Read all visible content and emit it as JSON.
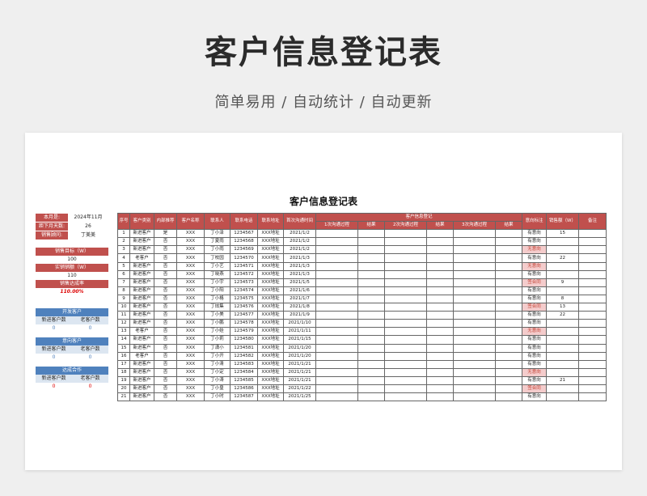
{
  "hero": {
    "title": "客户信息登记表",
    "subtitle": "简单易用  /  自动统计  /  自动更新"
  },
  "sheet_title": "客户信息登记表",
  "side": {
    "month_label": "本月是:",
    "month_value": "2024年11月",
    "days_label": "距下月天数:",
    "days_value": "26",
    "sales_label": "销售顾问:",
    "sales_value": "丁美美",
    "target_label": "销售目标（W）",
    "target_value": "100",
    "actual_label": "实销销额（W）",
    "actual_value": "110",
    "rate_label": "销售达成率",
    "rate_value": "110.00%",
    "blocks": [
      {
        "title": "开发客户",
        "col_a": "新进客户数",
        "col_b": "老客户数",
        "val_a": "0",
        "val_b": "0"
      },
      {
        "title": "意向客户",
        "col_a": "新进客户数",
        "col_b": "老客户数",
        "val_a": "0",
        "val_b": "0"
      },
      {
        "title": "达成合作",
        "col_a": "新进客户数",
        "col_b": "老客户数",
        "val_a": "0",
        "val_b": "0"
      }
    ]
  },
  "table": {
    "headers": [
      "序号",
      "客户类别",
      "内部推荐",
      "客户名称",
      "联系人",
      "联系电话",
      "联系地址",
      "首次沟通时间"
    ],
    "group_header": "客户信息登记",
    "sub_headers": [
      "1次沟通过程",
      "结果",
      "2次沟通过程",
      "结果",
      "3次沟通过程",
      "结果"
    ],
    "tail_headers": [
      "意向标注",
      "销售额（W）",
      "备注"
    ],
    "rows": [
      [
        "1",
        "新进客户",
        "是",
        "XXX",
        "丁小泽",
        "1234567",
        "XXX地址",
        "2021/1/2",
        "有意向",
        "15"
      ],
      [
        "2",
        "新进客户",
        "否",
        "XXX",
        "丁夏雨",
        "1234568",
        "XXX地址",
        "2021/1/2",
        "有意向",
        ""
      ],
      [
        "3",
        "新进客户",
        "否",
        "XXX",
        "丁小雨",
        "1234569",
        "XXX地址",
        "2021/1/2",
        "无意向",
        ""
      ],
      [
        "4",
        "老客户",
        "否",
        "XXX",
        "丁校园",
        "1234570",
        "XXX地址",
        "2021/1/3",
        "有意向",
        "22"
      ],
      [
        "5",
        "新进客户",
        "否",
        "XXX",
        "丁小艺",
        "1234571",
        "XXX地址",
        "2021/1/3",
        "无意向",
        ""
      ],
      [
        "6",
        "新进客户",
        "否",
        "XXX",
        "丁晓燕",
        "1234572",
        "XXX地址",
        "2021/1/3",
        "有意向",
        ""
      ],
      [
        "7",
        "新进客户",
        "否",
        "XXX",
        "丁小宇",
        "1234573",
        "XXX地址",
        "2021/1/5",
        "签合同",
        "9"
      ],
      [
        "8",
        "新进客户",
        "否",
        "XXX",
        "丁小阳",
        "1234574",
        "XXX地址",
        "2021/1/6",
        "有意向",
        ""
      ],
      [
        "9",
        "新进客户",
        "否",
        "XXX",
        "丁小格",
        "1234575",
        "XXX地址",
        "2021/1/7",
        "有意向",
        "8"
      ],
      [
        "10",
        "新进客户",
        "否",
        "XXX",
        "丁炫集",
        "1234576",
        "XXX地址",
        "2021/1/8",
        "签合同",
        "13"
      ],
      [
        "11",
        "新进客户",
        "否",
        "XXX",
        "丁小美",
        "1234577",
        "XXX地址",
        "2021/1/9",
        "有意向",
        "22"
      ],
      [
        "12",
        "新进客户",
        "否",
        "XXX",
        "丁小鹏",
        "1234578",
        "XXX地址",
        "2021/1/10",
        "有意向",
        ""
      ],
      [
        "13",
        "老客户",
        "否",
        "XXX",
        "丁小娃",
        "1234579",
        "XXX地址",
        "2021/1/11",
        "无意向",
        ""
      ],
      [
        "14",
        "新进客户",
        "否",
        "XXX",
        "丁小莉",
        "1234580",
        "XXX地址",
        "2021/1/15",
        "有意向",
        ""
      ],
      [
        "15",
        "新进客户",
        "否",
        "XXX",
        "丁潇小",
        "1234581",
        "XXX地址",
        "2021/1/20",
        "有意向",
        ""
      ],
      [
        "16",
        "老客户",
        "否",
        "XXX",
        "丁小开",
        "1234582",
        "XXX地址",
        "2021/1/20",
        "有意向",
        ""
      ],
      [
        "17",
        "新进客户",
        "否",
        "XXX",
        "丁小清",
        "1234583",
        "XXX地址",
        "2021/1/21",
        "有意向",
        ""
      ],
      [
        "18",
        "新进客户",
        "否",
        "XXX",
        "丁小定",
        "1234584",
        "XXX地址",
        "2021/1/21",
        "无意向",
        ""
      ],
      [
        "19",
        "新进客户",
        "否",
        "XXX",
        "丁小涛",
        "1234585",
        "XXX地址",
        "2021/1/21",
        "有意向",
        "21"
      ],
      [
        "20",
        "新进客户",
        "否",
        "XXX",
        "丁小皇",
        "1234586",
        "XXX地址",
        "2021/1/22",
        "签合同",
        ""
      ],
      [
        "21",
        "新进客户",
        "否",
        "XXX",
        "丁小时",
        "1234587",
        "XXX地址",
        "2021/1/25",
        "有意向",
        ""
      ]
    ]
  },
  "colors": {
    "red_header": "#c0504d",
    "blue_header": "#4f81bd",
    "tag_bg": "#f4cccc"
  }
}
